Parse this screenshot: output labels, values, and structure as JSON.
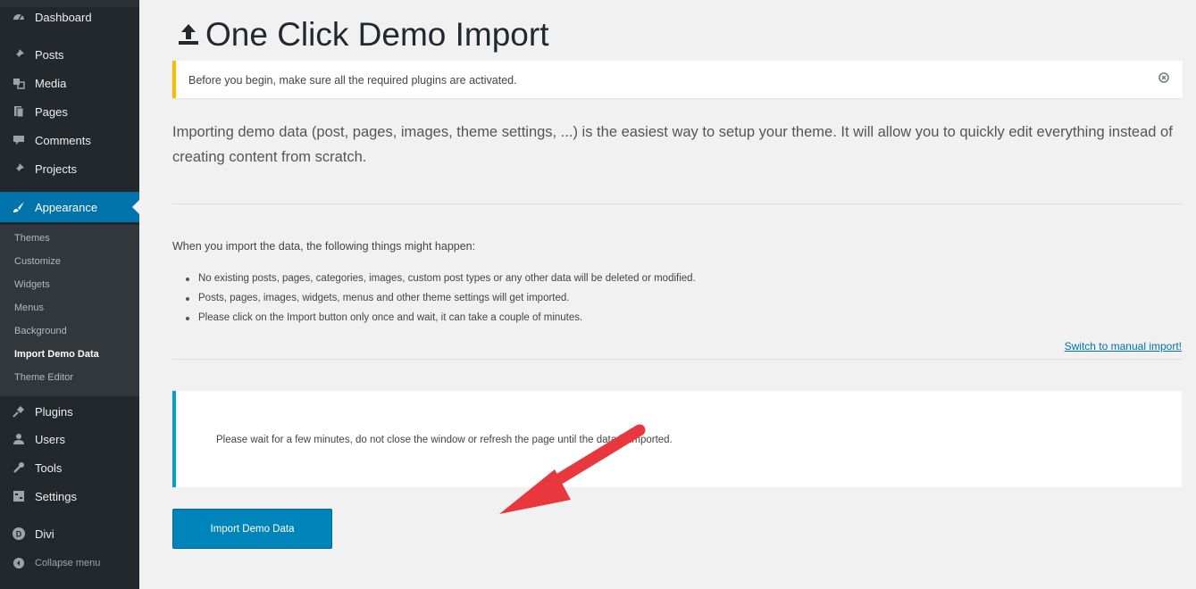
{
  "sidebar": {
    "menu": [
      {
        "label": "Dashboard",
        "icon": "dashboard-icon"
      },
      {
        "label": "Posts",
        "icon": "pin-icon"
      },
      {
        "label": "Media",
        "icon": "media-icon"
      },
      {
        "label": "Pages",
        "icon": "pages-icon"
      },
      {
        "label": "Comments",
        "icon": "comments-icon"
      },
      {
        "label": "Projects",
        "icon": "pin-icon"
      },
      {
        "label": "Appearance",
        "icon": "paintbrush-icon"
      }
    ],
    "submenu": [
      {
        "label": "Themes"
      },
      {
        "label": "Customize"
      },
      {
        "label": "Widgets"
      },
      {
        "label": "Menus"
      },
      {
        "label": "Background"
      },
      {
        "label": "Import Demo Data"
      },
      {
        "label": "Theme Editor"
      }
    ],
    "menu_bottom": [
      {
        "label": "Plugins",
        "icon": "plugins-icon"
      },
      {
        "label": "Users",
        "icon": "users-icon"
      },
      {
        "label": "Tools",
        "icon": "tools-icon"
      },
      {
        "label": "Settings",
        "icon": "settings-icon"
      },
      {
        "label": "Divi",
        "icon": "divi-icon"
      },
      {
        "label": "Collapse menu",
        "icon": "collapse-icon"
      }
    ]
  },
  "main": {
    "title": "One Click Demo Import",
    "notice": "Before you begin, make sure all the required plugins are activated.",
    "intro": "Importing demo data (post, pages, images, theme settings, ...) is the easiest way to setup your theme. It will allow you to quickly edit everything instead of creating content from scratch.",
    "what_happens": "When you import the data, the following things might happen:",
    "bullets": [
      "No existing posts, pages, categories, images, custom post types or any other data will be deleted or modified.",
      "Posts, pages, images, widgets, menus and other theme settings will get imported.",
      "Please click on the Import button only once and wait, it can take a couple of minutes."
    ],
    "manual_link": "Switch to manual import!",
    "wait_message": "Please wait for a few minutes, do not close the window or refresh the page until the data is imported.",
    "import_button": "Import Demo Data"
  },
  "colors": {
    "sidebar_bg": "#23282d",
    "accent": "#0073aa",
    "button": "#0085ba",
    "notice_border": "#ffb900",
    "info_border": "#00a0d2",
    "arrow": "#e8383d"
  }
}
